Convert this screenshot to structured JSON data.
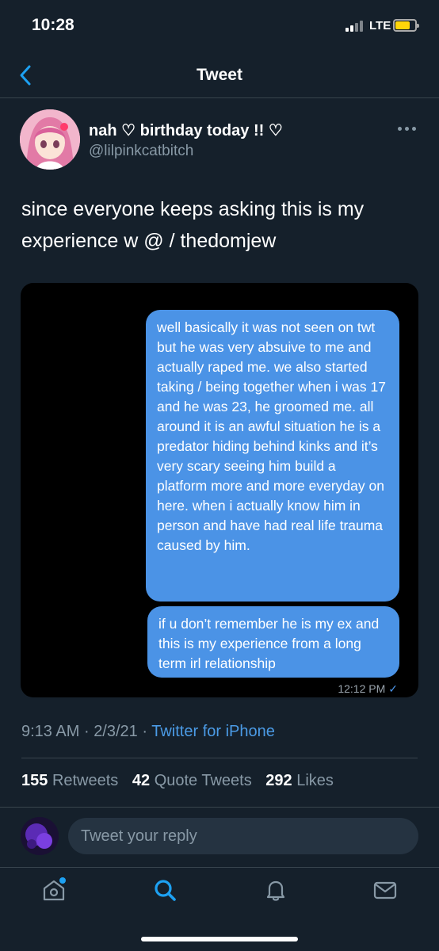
{
  "status_bar": {
    "time": "10:28",
    "network": "LTE",
    "battery_color": "#ffd60a",
    "signal_icon": "cellular-signal-icon",
    "battery_icon": "battery-icon"
  },
  "nav": {
    "title": "Tweet",
    "back_icon": "chevron-left-icon"
  },
  "tweet": {
    "display_name": "nah ♡ birthday today !! ♡",
    "handle": "@lilpinkcatbitch",
    "more_icon": "more-horizontal-icon",
    "text": "since everyone keeps asking this is my experience w @ / thedomjew",
    "media": {
      "messages": [
        "well basically it was not seen on twt but he was very absuive to me and actually raped me. we also started taking / being together when i was 17 and he was 23, he groomed me. all around it is an awful situation he is a predator hiding behind kinks and it’s very scary seeing him build a platform more and more everyday on here. when i actually know him in person and have had real life trauma caused by him.",
        "if u don’t remember he is my ex and this is my experience from a long term irl relationship"
      ],
      "timestamp": "12:12 PM",
      "read_mark": "✓",
      "bubble_color": "#4b93e6"
    },
    "time": "9:13 AM",
    "date": "2/3/21",
    "separator": "·",
    "source": "Twitter for iPhone",
    "stats": {
      "retweets_count": "155",
      "retweets_label": "Retweets",
      "quotes_count": "42",
      "quotes_label": "Quote Tweets",
      "likes_count": "292",
      "likes_label": "Likes"
    }
  },
  "reply": {
    "placeholder": "Tweet your reply"
  },
  "tab_bar": {
    "tabs": [
      {
        "name": "home",
        "icon": "home-icon",
        "notification_dot": true
      },
      {
        "name": "search",
        "icon": "search-icon",
        "active": true
      },
      {
        "name": "notifications",
        "icon": "bell-icon"
      },
      {
        "name": "messages",
        "icon": "mail-icon"
      }
    ],
    "accent_color": "#1da1f2"
  }
}
